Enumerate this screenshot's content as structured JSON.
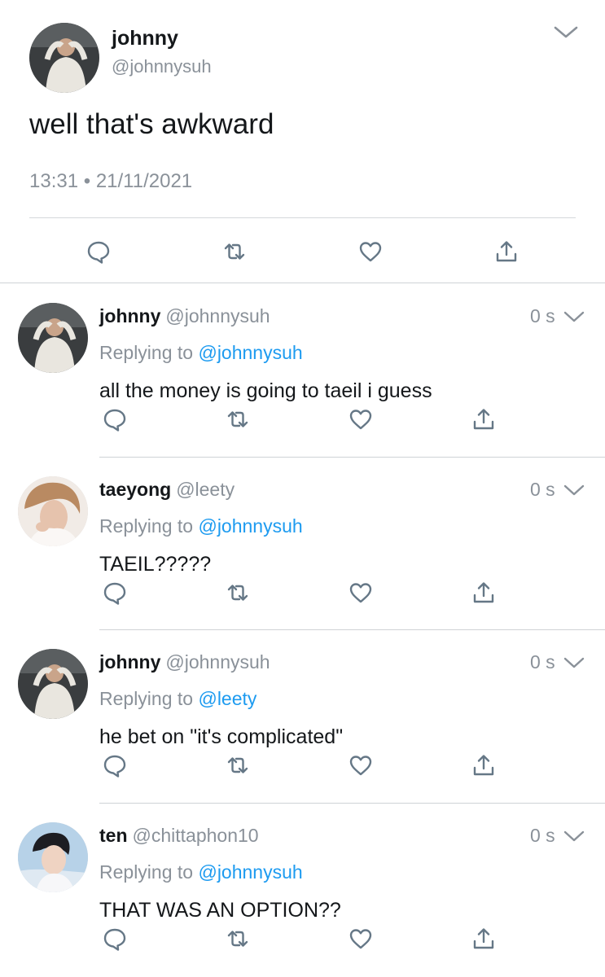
{
  "main_tweet": {
    "name": "johnny",
    "handle": "@johnnysuh",
    "text": "well that's awkward",
    "time": "13:31",
    "separator": "•",
    "date": "21/11/2021"
  },
  "replies": [
    {
      "name": "johnny",
      "handle": "@johnnysuh",
      "time": "0 s",
      "replying_label": "Replying to",
      "replying_to": "@johnnysuh",
      "text": "all the money is going to taeil i guess"
    },
    {
      "name": "taeyong",
      "handle": "@leety",
      "time": "0 s",
      "replying_label": "Replying to",
      "replying_to": "@johnnysuh",
      "text": "TAEIL?????"
    },
    {
      "name": "johnny",
      "handle": "@johnnysuh",
      "time": "0 s",
      "replying_label": "Replying to",
      "replying_to": "@leety",
      "text": "he bet on \"it's complicated\""
    },
    {
      "name": "ten",
      "handle": "@chittaphon10",
      "time": "0 s",
      "replying_label": "Replying to",
      "replying_to": "@johnnysuh",
      "text": "THAT WAS AN OPTION??"
    }
  ],
  "icons": {
    "reply": "reply-icon",
    "retweet": "retweet-icon",
    "like": "like-icon",
    "share": "share-icon",
    "more": "chevron-down-icon"
  },
  "colors": {
    "icon": "#657786",
    "mention": "#1d9bf0",
    "secondary_text": "#8a9199"
  }
}
